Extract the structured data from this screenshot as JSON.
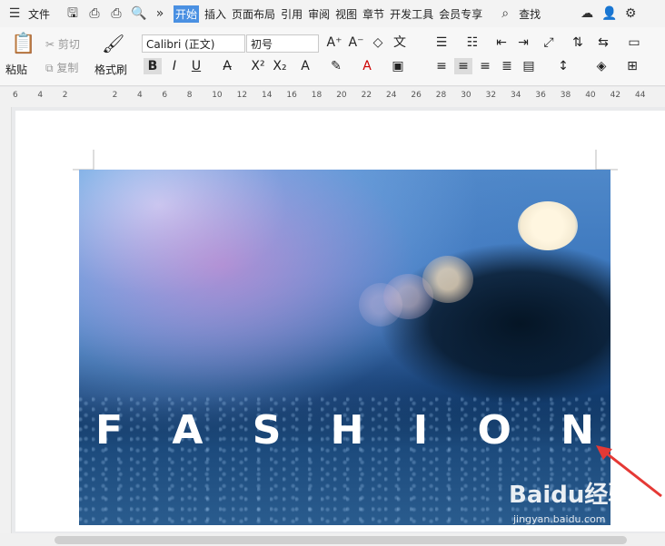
{
  "menubar": {
    "file_label": "文件",
    "tabs": [
      "开始",
      "插入",
      "页面布局",
      "引用",
      "审阅",
      "视图",
      "章节",
      "开发工具",
      "会员专享"
    ],
    "active_tab_index": 0,
    "search_label": "查找"
  },
  "ribbon": {
    "paste_label": "粘贴",
    "cut_label": "剪切",
    "copy_label": "复制",
    "format_painter_label": "格式刷",
    "font_family": "Calibri (正文)",
    "font_size": "初号"
  },
  "ruler": {
    "ticks": [
      "6",
      "4",
      "2",
      "",
      "2",
      "4",
      "6",
      "8",
      "10",
      "12",
      "14",
      "16",
      "18",
      "20",
      "22",
      "24",
      "26",
      "28",
      "30",
      "32",
      "34",
      "36",
      "38",
      "40",
      "42",
      "44"
    ]
  },
  "document": {
    "image_text_letters": [
      "F",
      "A",
      "S",
      "H",
      "I",
      "O",
      "N"
    ],
    "watermark_brand": "Baidu经验",
    "watermark_url": "jingyan.baidu.com"
  },
  "colors": {
    "accent": "#4a90e2",
    "arrow": "#e53935"
  }
}
